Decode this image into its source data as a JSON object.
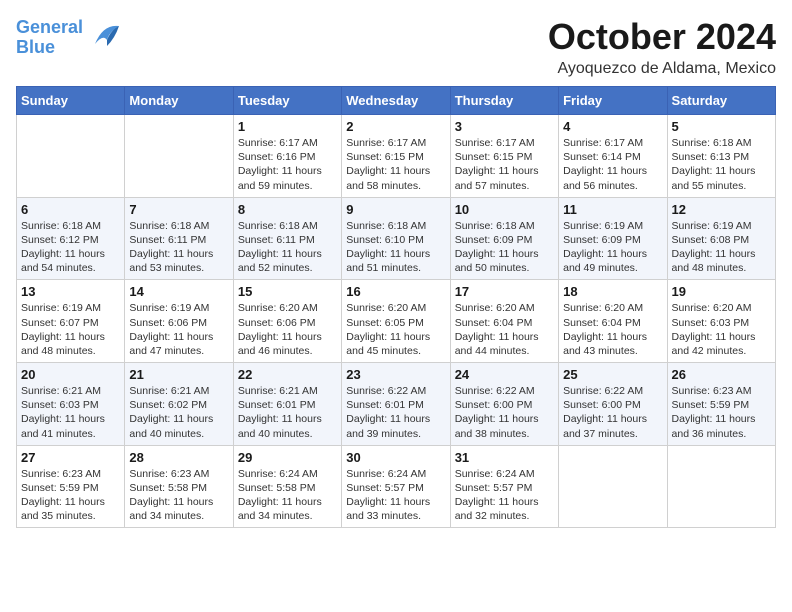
{
  "logo": {
    "line1": "General",
    "line2": "Blue",
    "bird": "▶"
  },
  "title": "October 2024",
  "location": "Ayoquezco de Aldama, Mexico",
  "days_of_week": [
    "Sunday",
    "Monday",
    "Tuesday",
    "Wednesday",
    "Thursday",
    "Friday",
    "Saturday"
  ],
  "weeks": [
    [
      {
        "day": "",
        "info": ""
      },
      {
        "day": "",
        "info": ""
      },
      {
        "day": "1",
        "info": "Sunrise: 6:17 AM\nSunset: 6:16 PM\nDaylight: 11 hours and 59 minutes."
      },
      {
        "day": "2",
        "info": "Sunrise: 6:17 AM\nSunset: 6:15 PM\nDaylight: 11 hours and 58 minutes."
      },
      {
        "day": "3",
        "info": "Sunrise: 6:17 AM\nSunset: 6:15 PM\nDaylight: 11 hours and 57 minutes."
      },
      {
        "day": "4",
        "info": "Sunrise: 6:17 AM\nSunset: 6:14 PM\nDaylight: 11 hours and 56 minutes."
      },
      {
        "day": "5",
        "info": "Sunrise: 6:18 AM\nSunset: 6:13 PM\nDaylight: 11 hours and 55 minutes."
      }
    ],
    [
      {
        "day": "6",
        "info": "Sunrise: 6:18 AM\nSunset: 6:12 PM\nDaylight: 11 hours and 54 minutes."
      },
      {
        "day": "7",
        "info": "Sunrise: 6:18 AM\nSunset: 6:11 PM\nDaylight: 11 hours and 53 minutes."
      },
      {
        "day": "8",
        "info": "Sunrise: 6:18 AM\nSunset: 6:11 PM\nDaylight: 11 hours and 52 minutes."
      },
      {
        "day": "9",
        "info": "Sunrise: 6:18 AM\nSunset: 6:10 PM\nDaylight: 11 hours and 51 minutes."
      },
      {
        "day": "10",
        "info": "Sunrise: 6:18 AM\nSunset: 6:09 PM\nDaylight: 11 hours and 50 minutes."
      },
      {
        "day": "11",
        "info": "Sunrise: 6:19 AM\nSunset: 6:09 PM\nDaylight: 11 hours and 49 minutes."
      },
      {
        "day": "12",
        "info": "Sunrise: 6:19 AM\nSunset: 6:08 PM\nDaylight: 11 hours and 48 minutes."
      }
    ],
    [
      {
        "day": "13",
        "info": "Sunrise: 6:19 AM\nSunset: 6:07 PM\nDaylight: 11 hours and 48 minutes."
      },
      {
        "day": "14",
        "info": "Sunrise: 6:19 AM\nSunset: 6:06 PM\nDaylight: 11 hours and 47 minutes."
      },
      {
        "day": "15",
        "info": "Sunrise: 6:20 AM\nSunset: 6:06 PM\nDaylight: 11 hours and 46 minutes."
      },
      {
        "day": "16",
        "info": "Sunrise: 6:20 AM\nSunset: 6:05 PM\nDaylight: 11 hours and 45 minutes."
      },
      {
        "day": "17",
        "info": "Sunrise: 6:20 AM\nSunset: 6:04 PM\nDaylight: 11 hours and 44 minutes."
      },
      {
        "day": "18",
        "info": "Sunrise: 6:20 AM\nSunset: 6:04 PM\nDaylight: 11 hours and 43 minutes."
      },
      {
        "day": "19",
        "info": "Sunrise: 6:20 AM\nSunset: 6:03 PM\nDaylight: 11 hours and 42 minutes."
      }
    ],
    [
      {
        "day": "20",
        "info": "Sunrise: 6:21 AM\nSunset: 6:03 PM\nDaylight: 11 hours and 41 minutes."
      },
      {
        "day": "21",
        "info": "Sunrise: 6:21 AM\nSunset: 6:02 PM\nDaylight: 11 hours and 40 minutes."
      },
      {
        "day": "22",
        "info": "Sunrise: 6:21 AM\nSunset: 6:01 PM\nDaylight: 11 hours and 40 minutes."
      },
      {
        "day": "23",
        "info": "Sunrise: 6:22 AM\nSunset: 6:01 PM\nDaylight: 11 hours and 39 minutes."
      },
      {
        "day": "24",
        "info": "Sunrise: 6:22 AM\nSunset: 6:00 PM\nDaylight: 11 hours and 38 minutes."
      },
      {
        "day": "25",
        "info": "Sunrise: 6:22 AM\nSunset: 6:00 PM\nDaylight: 11 hours and 37 minutes."
      },
      {
        "day": "26",
        "info": "Sunrise: 6:23 AM\nSunset: 5:59 PM\nDaylight: 11 hours and 36 minutes."
      }
    ],
    [
      {
        "day": "27",
        "info": "Sunrise: 6:23 AM\nSunset: 5:59 PM\nDaylight: 11 hours and 35 minutes."
      },
      {
        "day": "28",
        "info": "Sunrise: 6:23 AM\nSunset: 5:58 PM\nDaylight: 11 hours and 34 minutes."
      },
      {
        "day": "29",
        "info": "Sunrise: 6:24 AM\nSunset: 5:58 PM\nDaylight: 11 hours and 34 minutes."
      },
      {
        "day": "30",
        "info": "Sunrise: 6:24 AM\nSunset: 5:57 PM\nDaylight: 11 hours and 33 minutes."
      },
      {
        "day": "31",
        "info": "Sunrise: 6:24 AM\nSunset: 5:57 PM\nDaylight: 11 hours and 32 minutes."
      },
      {
        "day": "",
        "info": ""
      },
      {
        "day": "",
        "info": ""
      }
    ]
  ]
}
